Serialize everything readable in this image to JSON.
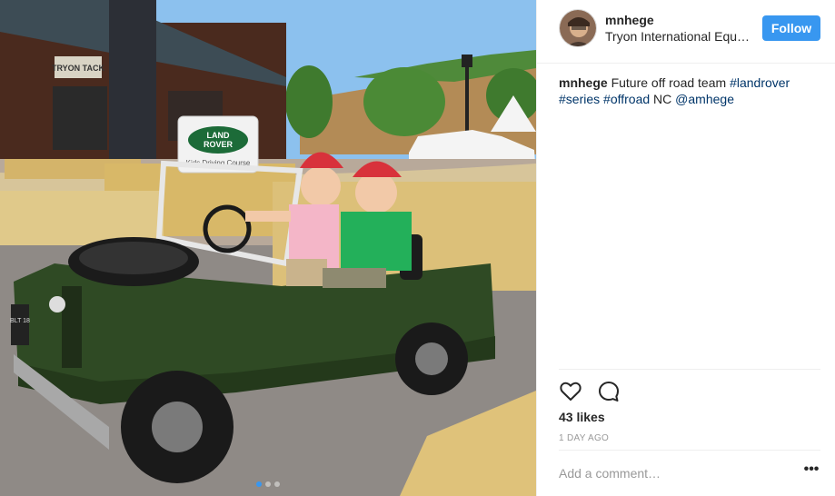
{
  "post": {
    "username": "mnhege",
    "location": "Tryon International Equestrian Center",
    "follow_label": "Follow",
    "caption": {
      "username": "mnhege",
      "text_1": "Future off road team",
      "hashtag_1": "#landrover",
      "hashtag_2": "#series",
      "hashtag_3": "#offroad",
      "text_2": "NC",
      "mention": "@amhege"
    },
    "likes": "43 likes",
    "timestamp": "1 DAY AGO",
    "comment_placeholder": "Add a comment…",
    "more_label": "•••"
  },
  "photo": {
    "sign_text": "TRYON TACK",
    "logo_text_1": "LAND",
    "logo_text_2": "ROVER",
    "course_text": "Kids Driving Course",
    "plate_text": "BLT 18"
  },
  "carousel": {
    "count": 3,
    "active": 0
  },
  "icons": {
    "like": "heart-icon",
    "comment": "comment-bubble-icon",
    "more": "more-options-icon"
  },
  "colors": {
    "accent": "#3897f0",
    "hashtag": "#003569",
    "muted": "#999999",
    "jeep": "#2f4a24",
    "cap": "#d8323b"
  }
}
